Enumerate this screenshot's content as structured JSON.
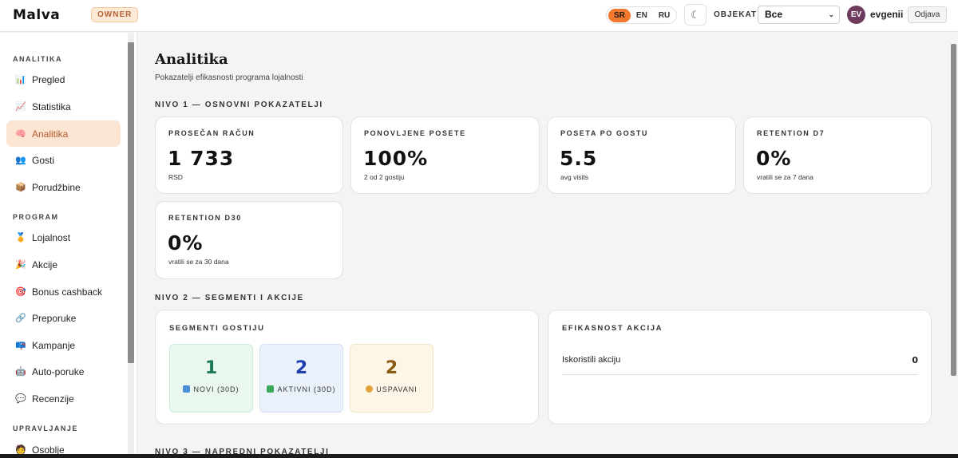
{
  "header": {
    "logo": "Malva",
    "role_badge": "OWNER",
    "languages": [
      {
        "code": "SR",
        "active": true
      },
      {
        "code": "EN",
        "active": false
      },
      {
        "code": "RU",
        "active": false
      }
    ],
    "theme_icon": "moon-icon",
    "theme_glyph": "☾",
    "objekat_label": "OBJEKAT",
    "objekat_value": "Все",
    "avatar_initials": "EV",
    "username": "evgenii",
    "logout_label": "Odjava",
    "accent_color": "#f2782e"
  },
  "sidebar": {
    "sections": [
      {
        "title": "ANALITIKA",
        "items": [
          {
            "label": "Pregled",
            "icon": "bar-chart-icon",
            "glyph": "📊",
            "active": false
          },
          {
            "label": "Statistika",
            "icon": "line-chart-icon",
            "glyph": "📈",
            "active": false
          },
          {
            "label": "Analitika",
            "icon": "brain-icon",
            "glyph": "🧠",
            "active": true
          },
          {
            "label": "Gosti",
            "icon": "people-icon",
            "glyph": "👥",
            "active": false
          },
          {
            "label": "Porudžbine",
            "icon": "package-icon",
            "glyph": "📦",
            "active": false
          }
        ]
      },
      {
        "title": "PROGRAM",
        "items": [
          {
            "label": "Lojalnost",
            "icon": "medal-icon",
            "glyph": "🏅",
            "active": false
          },
          {
            "label": "Akcije",
            "icon": "party-icon",
            "glyph": "🎉",
            "active": false
          },
          {
            "label": "Bonus cashback",
            "icon": "target-icon",
            "glyph": "🎯",
            "active": false
          },
          {
            "label": "Preporuke",
            "icon": "link-icon",
            "glyph": "🔗",
            "active": false
          },
          {
            "label": "Kampanje",
            "icon": "mailbox-icon",
            "glyph": "📪",
            "active": false
          },
          {
            "label": "Auto-poruke",
            "icon": "robot-icon",
            "glyph": "🤖",
            "active": false
          },
          {
            "label": "Recenzije",
            "icon": "speech-bubble-icon",
            "glyph": "💬",
            "active": false
          }
        ]
      },
      {
        "title": "UPRAVLJANJE",
        "items": [
          {
            "label": "Osoblje",
            "icon": "person-icon",
            "glyph": "🧑",
            "active": false
          }
        ]
      }
    ]
  },
  "main": {
    "title": "Analitika",
    "subtitle": "Pokazatelji efikasnosti programa lojalnosti",
    "level1": {
      "title": "NIVO 1 — OSNOVNI POKAZATELJI",
      "cards": [
        {
          "label": "PROSEČAN RAČUN",
          "value": "1 733",
          "sub": "RSD"
        },
        {
          "label": "PONOVLJENE POSETE",
          "value": "100%",
          "sub": "2 od 2 gostiju"
        },
        {
          "label": "POSETA PO GOSTU",
          "value": "5.5",
          "sub": "avg visits"
        },
        {
          "label": "RETENTION D7",
          "value": "0%",
          "sub": "vratili se za 7 dana"
        },
        {
          "label": "RETENTION D30",
          "value": "0%",
          "sub": "vratili se za 30 dana"
        }
      ]
    },
    "level2": {
      "title": "NIVO 2 — SEGMENTI I AKCIJE",
      "segments": {
        "label": "SEGMENTI GOSTIJU",
        "items": [
          {
            "value": "1",
            "caption": "NOVI (30D)",
            "icon": "new-icon",
            "color": "#1b7a55",
            "bg": "#e9f7ef",
            "icon_color": "#4a8fd6"
          },
          {
            "value": "2",
            "caption": "AKTIVNI (30D)",
            "icon": "check-icon",
            "color": "#1f3fb0",
            "bg": "#eaf1fb",
            "icon_color": "#3aaa5a"
          },
          {
            "value": "2",
            "caption": "USPAVANI",
            "icon": "sleeping-face-icon",
            "color": "#8a5a10",
            "bg": "#fdf6e7",
            "icon_color": "#e2a33a"
          }
        ]
      },
      "efficiency": {
        "label": "EFIKASNOST AKCIJA",
        "rows": [
          {
            "label": "Iskoristili akciju",
            "value": "0"
          }
        ]
      }
    },
    "level3": {
      "title": "NIVO 3 — NAPREDNI POKAZATELJI"
    }
  }
}
